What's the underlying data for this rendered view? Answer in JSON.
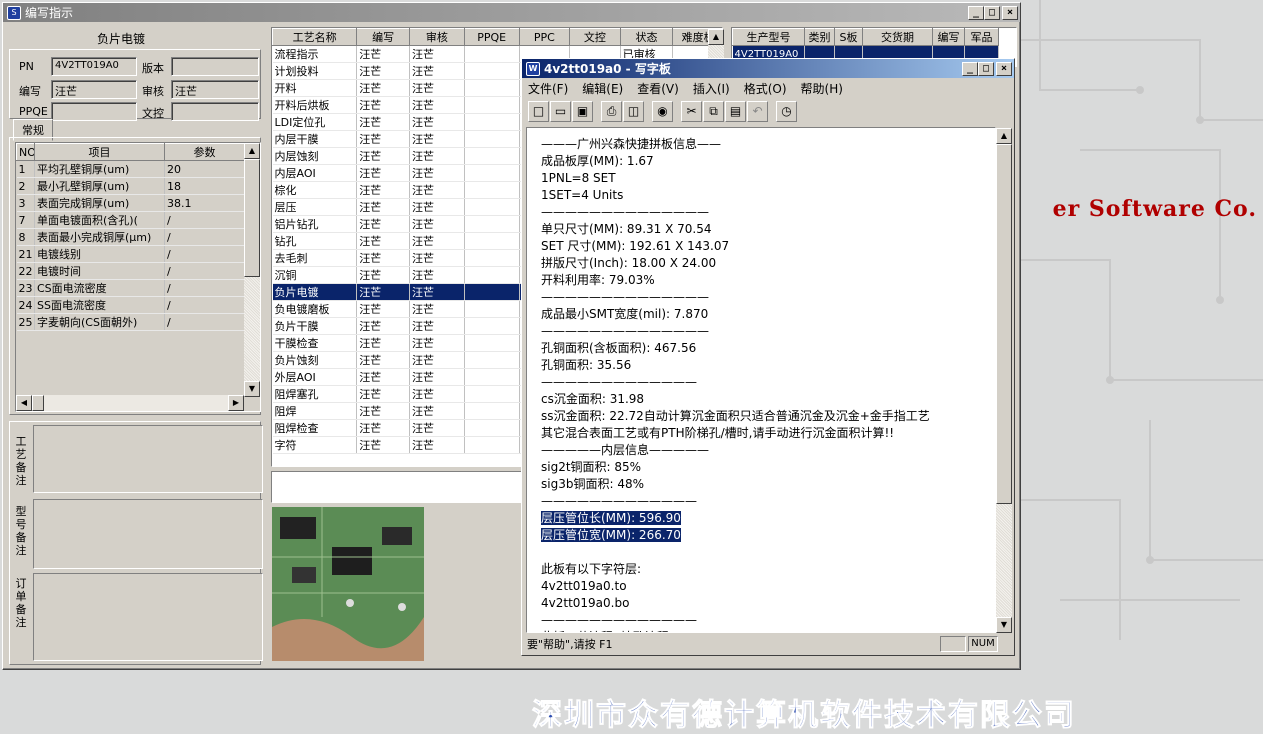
{
  "desktop": {
    "bg_text": "er Software Co.",
    "company_text": "深圳市众有德计算机软件技术有限公司"
  },
  "main_window": {
    "title": "编写指示",
    "left_panel": {
      "section_title": "负片电镀",
      "pn_label": "PN",
      "pn_value": "4V2TT019A0",
      "version_label": "版本",
      "version_value": "",
      "author_label": "编写",
      "author_value": "汪芒",
      "reviewer_label": "审核",
      "reviewer_value": "汪芒",
      "ppqe_label": "PPQE",
      "ppqe_value": "",
      "doccontrol_label": "文控",
      "doccontrol_value": "",
      "tab_label": "常规",
      "param_headers": [
        "NO",
        "项目",
        "参数"
      ],
      "params": [
        {
          "no": "1",
          "item": "平均孔壁铜厚(um)",
          "value": "20"
        },
        {
          "no": "2",
          "item": "最小孔壁铜厚(um)",
          "value": "18"
        },
        {
          "no": "3",
          "item": "表面完成铜厚(um)",
          "value": "38.1"
        },
        {
          "no": "7",
          "item": "单面电镀面积(含孔)(",
          "value": "/"
        },
        {
          "no": "8",
          "item": "表面最小完成铜厚(μm)",
          "value": "/"
        },
        {
          "no": "21",
          "item": "电镀线别",
          "value": "/"
        },
        {
          "no": "22",
          "item": "电镀时间",
          "value": "/"
        },
        {
          "no": "23",
          "item": "CS面电流密度",
          "value": "/"
        },
        {
          "no": "24",
          "item": "SS面电流密度",
          "value": "/"
        },
        {
          "no": "25",
          "item": "字麦朝向(CS面朝外)",
          "value": "/"
        }
      ],
      "note_labels": [
        "工艺备注",
        "型号备注",
        "订单备注"
      ]
    },
    "process_table": {
      "headers": [
        "工艺名称",
        "编写",
        "审核",
        "PPQE",
        "PPC",
        "文控",
        "状态",
        "难度板"
      ],
      "top_status": "已审核",
      "rows": [
        {
          "name": "流程指示",
          "author": "汪芒",
          "reviewer": "汪芒"
        },
        {
          "name": "计划投料",
          "author": "汪芒",
          "reviewer": "汪芒"
        },
        {
          "name": "开料",
          "author": "汪芒",
          "reviewer": "汪芒"
        },
        {
          "name": "开料后烘板",
          "author": "汪芒",
          "reviewer": "汪芒"
        },
        {
          "name": "LDI定位孔",
          "author": "汪芒",
          "reviewer": "汪芒"
        },
        {
          "name": "内层干膜",
          "author": "汪芒",
          "reviewer": "汪芒"
        },
        {
          "name": "内层蚀刻",
          "author": "汪芒",
          "reviewer": "汪芒"
        },
        {
          "name": "内层AOI",
          "author": "汪芒",
          "reviewer": "汪芒"
        },
        {
          "name": "棕化",
          "author": "汪芒",
          "reviewer": "汪芒"
        },
        {
          "name": "层压",
          "author": "汪芒",
          "reviewer": "汪芒"
        },
        {
          "name": "铝片钻孔",
          "author": "汪芒",
          "reviewer": "汪芒"
        },
        {
          "name": "钻孔",
          "author": "汪芒",
          "reviewer": "汪芒"
        },
        {
          "name": "去毛刺",
          "author": "汪芒",
          "reviewer": "汪芒"
        },
        {
          "name": "沉铜",
          "author": "汪芒",
          "reviewer": "汪芒"
        },
        {
          "name": "负片电镀",
          "author": "汪芒",
          "reviewer": "汪芒",
          "selected": true
        },
        {
          "name": "负电镀磨板",
          "author": "汪芒",
          "reviewer": "汪芒"
        },
        {
          "name": "负片干膜",
          "author": "汪芒",
          "reviewer": "汪芒"
        },
        {
          "name": "干膜检查",
          "author": "汪芒",
          "reviewer": "汪芒"
        },
        {
          "name": "负片蚀刻",
          "author": "汪芒",
          "reviewer": "汪芒"
        },
        {
          "name": "外层AOI",
          "author": "汪芒",
          "reviewer": "汪芒"
        },
        {
          "name": "阻焊塞孔",
          "author": "汪芒",
          "reviewer": "汪芒"
        },
        {
          "name": "阻焊",
          "author": "汪芒",
          "reviewer": "汪芒"
        },
        {
          "name": "阻焊检查",
          "author": "汪芒",
          "reviewer": "汪芒"
        },
        {
          "name": "字符",
          "author": "汪芒",
          "reviewer": "汪芒"
        }
      ]
    },
    "order_table": {
      "headers": [
        "生产型号",
        "类别",
        "S板",
        "交货期",
        "编写",
        "军品"
      ],
      "first_cell": "4V2TT019A0"
    }
  },
  "wordpad": {
    "title": "4v2tt019a0 - 写字板",
    "menus": [
      "文件(F)",
      "编辑(E)",
      "查看(V)",
      "插入(I)",
      "格式(O)",
      "帮助(H)"
    ],
    "toolbar_icons": [
      "new-icon",
      "open-icon",
      "save-icon",
      "print-icon",
      "print-preview-icon",
      "find-icon",
      "cut-icon",
      "copy-icon",
      "paste-icon",
      "undo-icon",
      "datetime-icon"
    ],
    "lines": [
      "———广州兴森快捷拼板信息——",
      "成品板厚(MM): 1.67",
      "1PNL=8 SET",
      "1SET=4 Units",
      "——————————————",
      "单只尺寸(MM): 89.31 X 70.54",
      "SET 尺寸(MM): 192.61 X 143.07",
      "拼版尺寸(Inch): 18.00 X 24.00",
      "开料利用率: 79.03%",
      "——————————————",
      "成品最小SMT宽度(mil): 7.870",
      "——————————————",
      "孔铜面积(含板面积): 467.56",
      "孔铜面积: 35.56",
      "—————————————",
      "cs沉金面积: 31.98",
      "ss沉金面积: 22.72自动计算沉金面积只适合普通沉金及沉金+金手指工艺",
      "其它混合表面工艺或有PTH阶梯孔/槽时,请手动进行沉金面积计算!!",
      "—————内层信息—————",
      "sig2t铜面积: 85%",
      "sig3b铜面积: 48%",
      "—————————————",
      "层压管位长(MM): 596.90",
      "层压管位宽(MM): 266.70",
      "",
      "此板有以下字符层:",
      "4v2tt019a0.to",
      "4v2tt019a0.bo",
      "—————————————",
      "此板工艺流程: 填孔流程"
    ],
    "status_text": "要\"帮助\",请按 F1",
    "status_num": "NUM"
  }
}
